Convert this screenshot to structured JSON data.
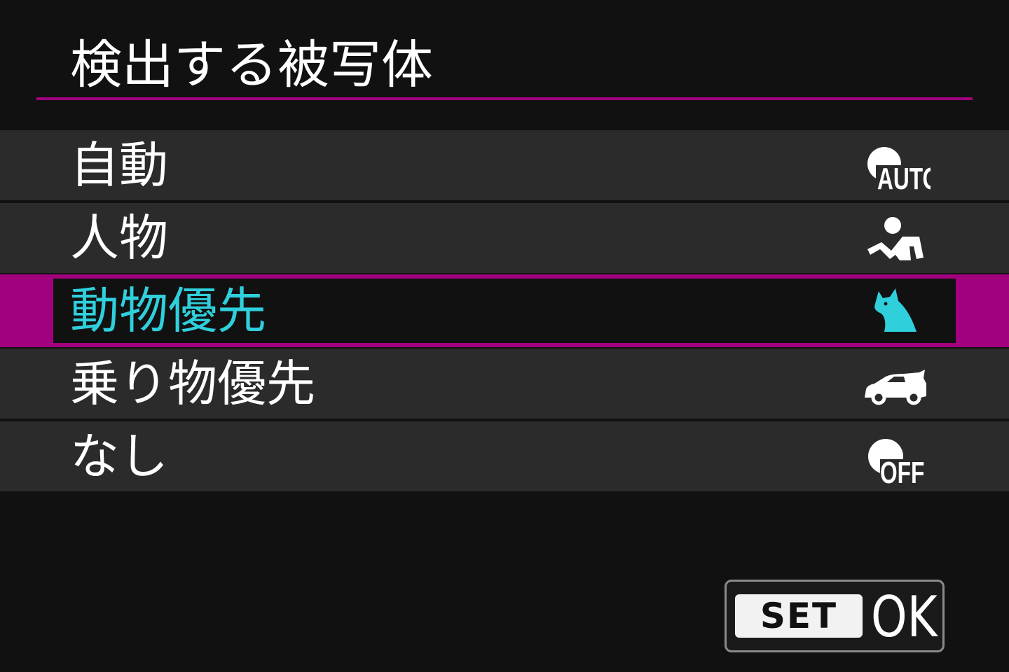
{
  "title": "検出する被写体",
  "options": [
    {
      "label": "自動",
      "icon": "subject-auto-icon",
      "icon_text": "AUTO",
      "selected": false
    },
    {
      "label": "人物",
      "icon": "person-icon",
      "selected": false
    },
    {
      "label": "動物優先",
      "icon": "animal-icon",
      "selected": true
    },
    {
      "label": "乗り物優先",
      "icon": "vehicle-icon",
      "selected": false
    },
    {
      "label": "なし",
      "icon": "subject-off-icon",
      "icon_text": "OFF",
      "selected": false
    }
  ],
  "footer": {
    "set_key_label": "SET",
    "confirm_label": "OK"
  },
  "colors": {
    "background": "#111111",
    "row_background": "#2b2b2b",
    "accent_magenta": "#a1007f",
    "selected_text": "#2fd0dc",
    "text": "#ffffff"
  }
}
